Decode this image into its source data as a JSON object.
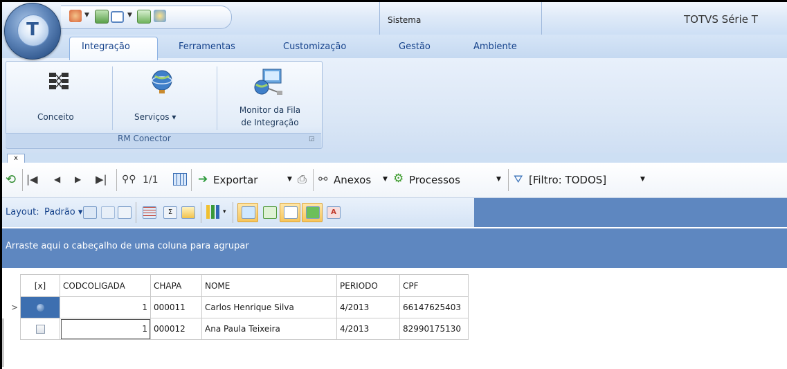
{
  "window": {
    "title": "TOTVS Série T",
    "context_tab": "Sistema"
  },
  "qat": {
    "icons": [
      "options-icon",
      "save-icon",
      "window-icon",
      "export-icon",
      "tools-icon"
    ]
  },
  "ribbon": {
    "tabs": [
      {
        "label": "Integração",
        "active": true
      },
      {
        "label": "Ferramentas",
        "active": false
      },
      {
        "label": "Customização",
        "active": false
      },
      {
        "label": "Gestão",
        "active": false
      },
      {
        "label": "Ambiente",
        "active": false
      }
    ],
    "group_label": "RM Conector",
    "buttons": {
      "conceito": "Conceito",
      "servicos": "Serviços",
      "monitor_line1": "Monitor da Fila",
      "monitor_line2": "de Integração"
    }
  },
  "doc_tab": {
    "close_label": "x"
  },
  "toolbar": {
    "page_indicator": "1/1",
    "exportar": "Exportar",
    "anexos": "Anexos",
    "processos": "Processos",
    "filtro": "[Filtro: TODOS]"
  },
  "layout_bar": {
    "label": "Layout:",
    "value": "Padrão"
  },
  "group_panel": {
    "text": "Arraste aqui o cabeçalho de uma coluna para agrupar"
  },
  "grid": {
    "columns": [
      "[x]",
      "CODCOLIGADA",
      "CHAPA",
      "NOME",
      "PERIODO",
      "CPF"
    ],
    "rows": [
      {
        "codcoligada": "1",
        "chapa": "000011",
        "nome": "Carlos Henrique Silva",
        "periodo": "4/2013",
        "cpf": "66147625403"
      },
      {
        "codcoligada": "1",
        "chapa": "000012",
        "nome": "Ana Paula Teixeira",
        "periodo": "4/2013",
        "cpf": "82990175130"
      }
    ],
    "current_row_indicator": ">"
  },
  "colors": {
    "accent": "#5e87c0",
    "tab_text": "#15428b",
    "ribbon_bg": "#dbe7f6"
  }
}
